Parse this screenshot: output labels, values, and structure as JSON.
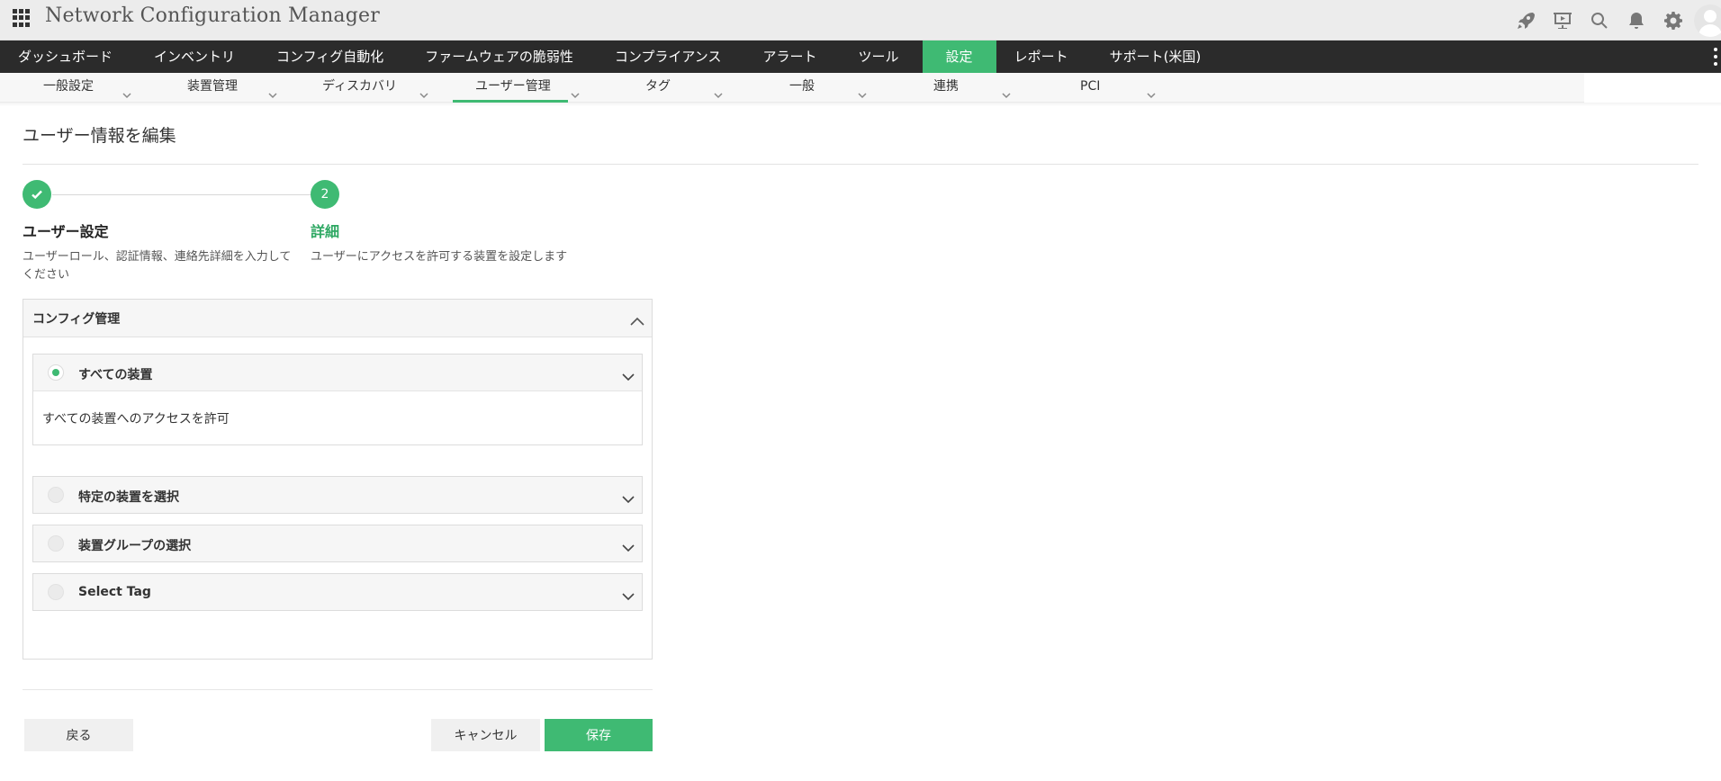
{
  "app": {
    "title": "Network Configuration Manager"
  },
  "topbar": {
    "icons": [
      "rocket-icon",
      "presentation-icon",
      "search-icon",
      "bell-icon",
      "gear-icon",
      "avatar"
    ]
  },
  "mainnav": {
    "items": [
      {
        "label": "ダッシュボード"
      },
      {
        "label": "インベントリ"
      },
      {
        "label": "コンフィグ自動化"
      },
      {
        "label": "ファームウェアの脆弱性"
      },
      {
        "label": "コンプライアンス"
      },
      {
        "label": "アラート"
      },
      {
        "label": "ツール"
      },
      {
        "label": "設定",
        "active": true
      },
      {
        "label": "レポート"
      },
      {
        "label": "サポート(米国)"
      }
    ]
  },
  "subnav": {
    "items": [
      {
        "label": "一般設定"
      },
      {
        "label": "装置管理"
      },
      {
        "label": "ディスカバリ"
      },
      {
        "label": "ユーザー管理",
        "active": true
      },
      {
        "label": "タグ"
      },
      {
        "label": "一般"
      },
      {
        "label": "連携"
      },
      {
        "label": "PCI"
      }
    ]
  },
  "page": {
    "title": "ユーザー情報を編集"
  },
  "steps": [
    {
      "number": "",
      "title": "ユーザー設定",
      "description": "ユーザーロール、認証情報、連絡先詳細を入力してください",
      "status": "completed"
    },
    {
      "number": "2",
      "title": "詳細",
      "description": "ユーザーにアクセスを許可する装置を設定します",
      "status": "current"
    }
  ],
  "panel": {
    "title": "コンフィグ管理",
    "options": [
      {
        "label": "すべての装置",
        "selected": true,
        "expanded": true,
        "body": "すべての装置へのアクセスを許可"
      },
      {
        "label": "特定の装置を選択",
        "selected": false,
        "expanded": false
      },
      {
        "label": "装置グループの選択",
        "selected": false,
        "expanded": false
      },
      {
        "label": "Select Tag",
        "selected": false,
        "expanded": false
      }
    ]
  },
  "buttons": {
    "back": "戻る",
    "cancel": "キャンセル",
    "save": "保存"
  },
  "colors": {
    "accent": "#3fba73",
    "nav_bg": "#2b2b2b",
    "topbar_bg": "#ececec"
  }
}
